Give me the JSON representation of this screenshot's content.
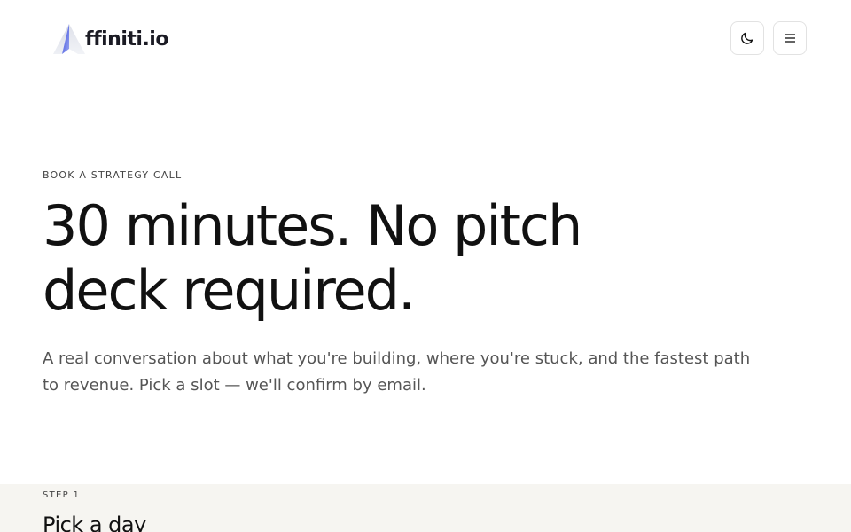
{
  "header": {
    "logo_text": "ffiniti.io",
    "logo_icon": "affiniti-a-logo",
    "theme_toggle_icon": "moon-icon",
    "menu_icon": "hamburger-menu-icon"
  },
  "hero": {
    "eyebrow": "BOOK A STRATEGY CALL",
    "headline": "30 minutes. No pitch deck required.",
    "lede": "A real conversation about what you're building, where you're stuck, and the fastest path to revenue. Pick a slot — we'll confirm by email."
  },
  "step": {
    "label": "STEP 1",
    "title": "Pick a day"
  },
  "colors": {
    "background": "#ffffff",
    "text": "#111111",
    "muted_text": "#555555",
    "step_background": "#f6f5f1",
    "border": "#e2e2e2",
    "logo_blue": "#2f3fd8"
  }
}
